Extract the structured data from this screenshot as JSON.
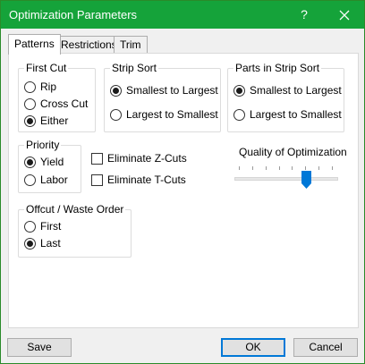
{
  "window": {
    "title": "Optimization Parameters",
    "help_glyph": "?"
  },
  "tabs": [
    {
      "label": "Patterns",
      "active": true
    },
    {
      "label": "Restrictions",
      "active": false
    },
    {
      "label": "Trim",
      "active": false
    }
  ],
  "first_cut": {
    "label": "First Cut",
    "options": [
      {
        "label": "Rip",
        "selected": false
      },
      {
        "label": "Cross Cut",
        "selected": false
      },
      {
        "label": "Either",
        "selected": true
      }
    ]
  },
  "strip_sort": {
    "label": "Strip Sort",
    "options": [
      {
        "label": "Smallest to Largest",
        "selected": true
      },
      {
        "label": "Largest to Smallest",
        "selected": false
      }
    ]
  },
  "parts_in_strip_sort": {
    "label": "Parts in Strip Sort",
    "options": [
      {
        "label": "Smallest to Largest",
        "selected": true
      },
      {
        "label": "Largest to Smallest",
        "selected": false
      }
    ]
  },
  "priority": {
    "label": "Priority",
    "options": [
      {
        "label": "Yield",
        "selected": true
      },
      {
        "label": "Labor",
        "selected": false
      }
    ]
  },
  "checkboxes": [
    {
      "label": "Eliminate Z-Cuts",
      "checked": false
    },
    {
      "label": "Eliminate T-Cuts",
      "checked": false
    }
  ],
  "quality": {
    "label": "Quality of Optimization",
    "ticks": 8,
    "value_fraction": 0.72
  },
  "offcut_order": {
    "label": "Offcut / Waste Order",
    "options": [
      {
        "label": "First",
        "selected": false
      },
      {
        "label": "Last",
        "selected": true
      }
    ]
  },
  "buttons": {
    "save": "Save",
    "ok": "OK",
    "cancel": "Cancel"
  },
  "colors": {
    "titlebar": "#15a33a",
    "default_button_border": "#0078d7"
  }
}
